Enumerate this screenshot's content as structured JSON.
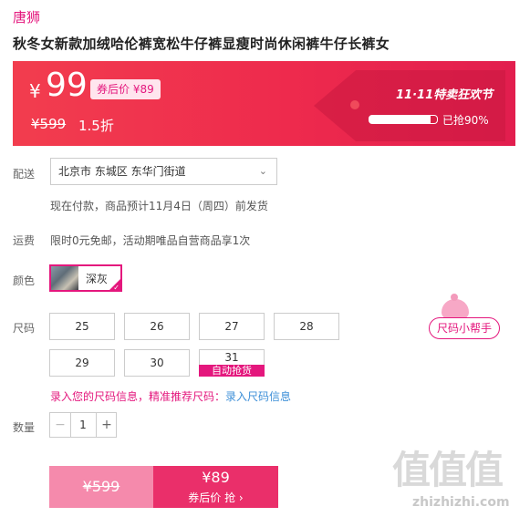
{
  "header": {
    "brand": "唐狮",
    "title": "秋冬女新款加绒哈伦裤宽松牛仔裤显瘦时尚休闲裤牛仔长裤女"
  },
  "price_banner": {
    "currency_symbol": "¥",
    "price": "99",
    "coupon_badge": "券后价 ¥89",
    "original_price": "¥599",
    "discount": "1.5折",
    "promo_title": "11·11特卖狂欢节",
    "sold_progress": 0.9,
    "sold_text": "已抢90%"
  },
  "delivery": {
    "label": "配送",
    "address": "北京市 东城区 东华门街道",
    "ship_note": "现在付款，商品预计11月4日（周四）前发货"
  },
  "freight": {
    "label": "运费",
    "text": "限时0元免邮，活动期唯品自营商品享1次"
  },
  "color": {
    "label": "颜色",
    "options": [
      {
        "name": "深灰",
        "selected": true
      }
    ]
  },
  "size": {
    "label": "尺码",
    "options": [
      "25",
      "26",
      "27",
      "28",
      "29",
      "30",
      "31"
    ],
    "auto_badge": "自动抢货",
    "helper_label": "尺码小帮手",
    "hint_text": "录入您的尺码信息，精准推荐尺码：",
    "hint_link": "录入尺码信息"
  },
  "quantity": {
    "label": "数量",
    "minus": "−",
    "value": "1",
    "plus": "+"
  },
  "buy": {
    "original_price": "¥599",
    "coupon_price": "¥89",
    "coupon_label": "券后价 抢 ›"
  },
  "watermark": {
    "big": "值值值",
    "small": "zhizhizhi.com"
  },
  "colors": {
    "accent": "#e4177d",
    "banner": "#ee2a4d",
    "link": "#3d8fd8"
  }
}
